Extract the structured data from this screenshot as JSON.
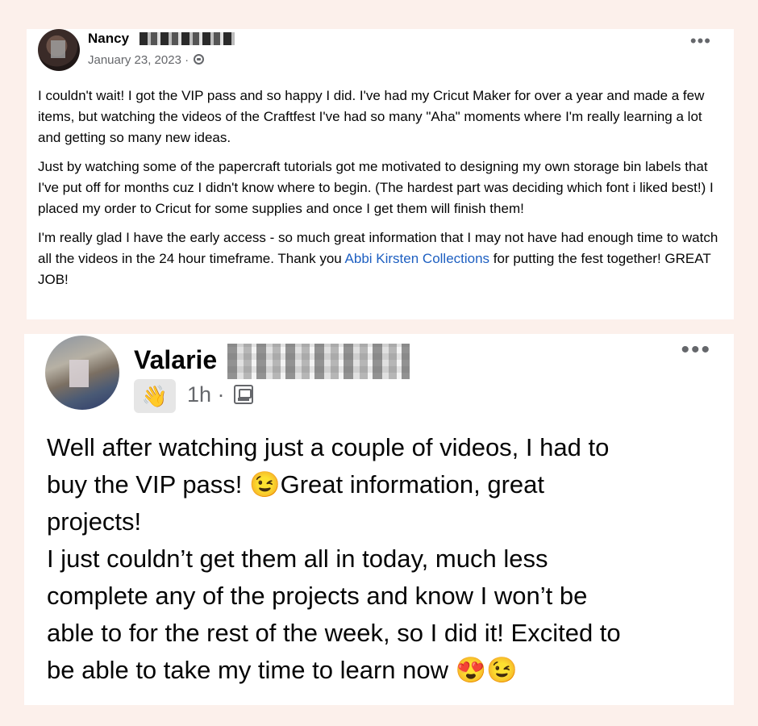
{
  "post1": {
    "author": "Nancy",
    "date": "January 23, 2023 ·",
    "privacy_icon": "globe-icon",
    "more_icon": "more-dots-icon",
    "paragraph1": "I couldn't wait!  I got the VIP pass and so happy I did.  I've had my Cricut Maker for over a year and made a few items,  but watching the videos of the Craftfest I've had so many \"Aha\" moments where I'm really learning a lot and getting so many new ideas.",
    "paragraph2": "Just by watching some of the papercraft tutorials got me motivated to designing my own storage bin labels that I've put off for months cuz I didn't know where to begin.  (The hardest part was deciding which font i liked best!)  I  placed my order to Cricut for some supplies and once I get them will finish them!",
    "paragraph3_start": "I'm really glad I have the early access -  so much great information that I may not have had enough time to watch all the videos in the 24 hour timeframe.  Thank you ",
    "paragraph3_link": "Abbi Kirsten Collections",
    "paragraph3_end": " for putting the fest together!  GREAT JOB!"
  },
  "post2": {
    "author": "Valarie",
    "badge_icon": "waving-hand-icon",
    "time": "1h ·",
    "audience_icon": "image-icon",
    "more_icon": "more-dots-icon",
    "line1": "Well after watching just a couple of videos, I had to",
    "line2": "buy the VIP pass!  😉Great information, great",
    "line3": "projects!",
    "line4": "I just couldn’t get them all in today, much less",
    "line5": "complete any of the projects and know I won’t be",
    "line6": "able to for the rest of the week, so I did it!  Excited to",
    "line7": "be able to take my time to learn now 😍😉"
  }
}
